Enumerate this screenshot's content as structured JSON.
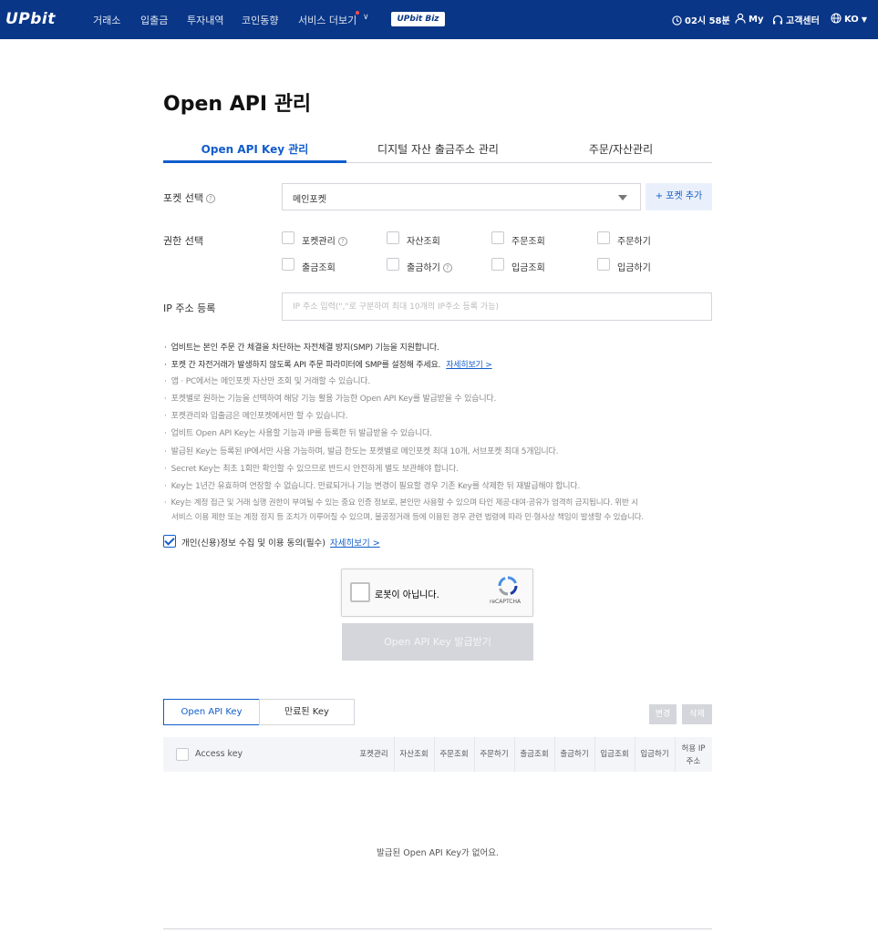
{
  "nav": {
    "logo": "UPbit",
    "items": [
      "거래소",
      "입출금",
      "투자내역",
      "코인동향",
      "서비스 더보기"
    ],
    "biz": "UPbit Biz",
    "time": "02시 58분",
    "my": "My",
    "support": "고객센터",
    "lang": "KO"
  },
  "page": {
    "title": "Open API 관리",
    "tabs": [
      "Open API Key 관리",
      "디지털 자산 출금주소 관리",
      "주문/자산관리"
    ]
  },
  "form": {
    "pocket_label": "포켓 선택",
    "pocket_value": "메인포켓",
    "add_pocket": "+ 포켓 추가",
    "perm_label": "권한 선택",
    "perms": [
      "포켓관리",
      "자산조회",
      "주문조회",
      "주문하기",
      "출금조회",
      "출금하기",
      "입금조회",
      "입금하기"
    ],
    "ip_label": "IP 주소 등록",
    "ip_placeholder": "IP 주소 입력(\",\"로 구분하여 최대 10개의 IP주소 등록 가능)"
  },
  "notes": [
    "업비트는 본인 주문 간 체결을 차단하는 자전체결 방지(SMP) 기능을 지원합니다.",
    "포켓 간 자전거래가 발생하지 않도록 API 주문 파라미터에 SMP를 설정해 주세요.",
    "앱 · PC에서는 메인포켓 자산만 조회 및 거래할 수 있습니다.",
    "포켓별로 원하는 기능을 선택하여 해당 기능 활용 가능한 Open API Key를 발급받을 수 있습니다.",
    "포켓관리와 입출금은 메인포켓에서만 할 수 있습니다.",
    "업비트 Open API Key는 사용할 기능과 IP를 등록한 뒤 발급받을 수 있습니다.",
    "발급된 Key는 등록된 IP에서만 사용 가능하며, 발급 한도는 포켓별로 메인포켓 최대 10개, 서브포켓 최대 5개입니다.",
    "Secret Key는 최초 1회만 확인할 수 있으므로 반드시 안전하게 별도 보관해야 합니다.",
    "Key는 1년간 유효하며 연장할 수 없습니다. 만료되거나 기능 변경이 필요할 경우 기존 Key를 삭제한 뒤 재발급해야 합니다.",
    "Key는 계정 접근 및 거래 실행 권한이 부여될 수 있는 중요 인증 정보로, 본인만 사용할 수 있으며 타인 제공·대여·공유가 엄격히 금지됩니다. 위반 시",
    "서비스 이용 제한 또는 계정 정지 등 조치가 이루어질 수 있으며, 불공정거래 등에 이용된 경우 관련 법령에 따라 민·형사상 책임이 발생할 수 있습니다."
  ],
  "notes_link": "자세히보기 >",
  "agree": {
    "text": "개인(신용)정보 수집 및 이용 동의(필수)",
    "link": "자세히보기 >"
  },
  "recaptcha": {
    "label": "로봇이 아닙니다.",
    "brand": "reCAPTCHA"
  },
  "issue_button": "Open API Key 발급받기",
  "key_tabs": [
    "Open API Key",
    "만료된 Key"
  ],
  "actions": [
    "변경",
    "삭제"
  ],
  "table": {
    "columns": [
      "Access key",
      "포켓관리",
      "자산조회",
      "주문조회",
      "주문하기",
      "출금조회",
      "출금하기",
      "입금조회",
      "입금하기",
      "허용 IP",
      "주소"
    ],
    "empty": "발급된 Open API Key가 없어요."
  },
  "colors": {
    "nav_bg": "#093687",
    "accent": "#115dcb",
    "disabled": "#d4d6db"
  }
}
